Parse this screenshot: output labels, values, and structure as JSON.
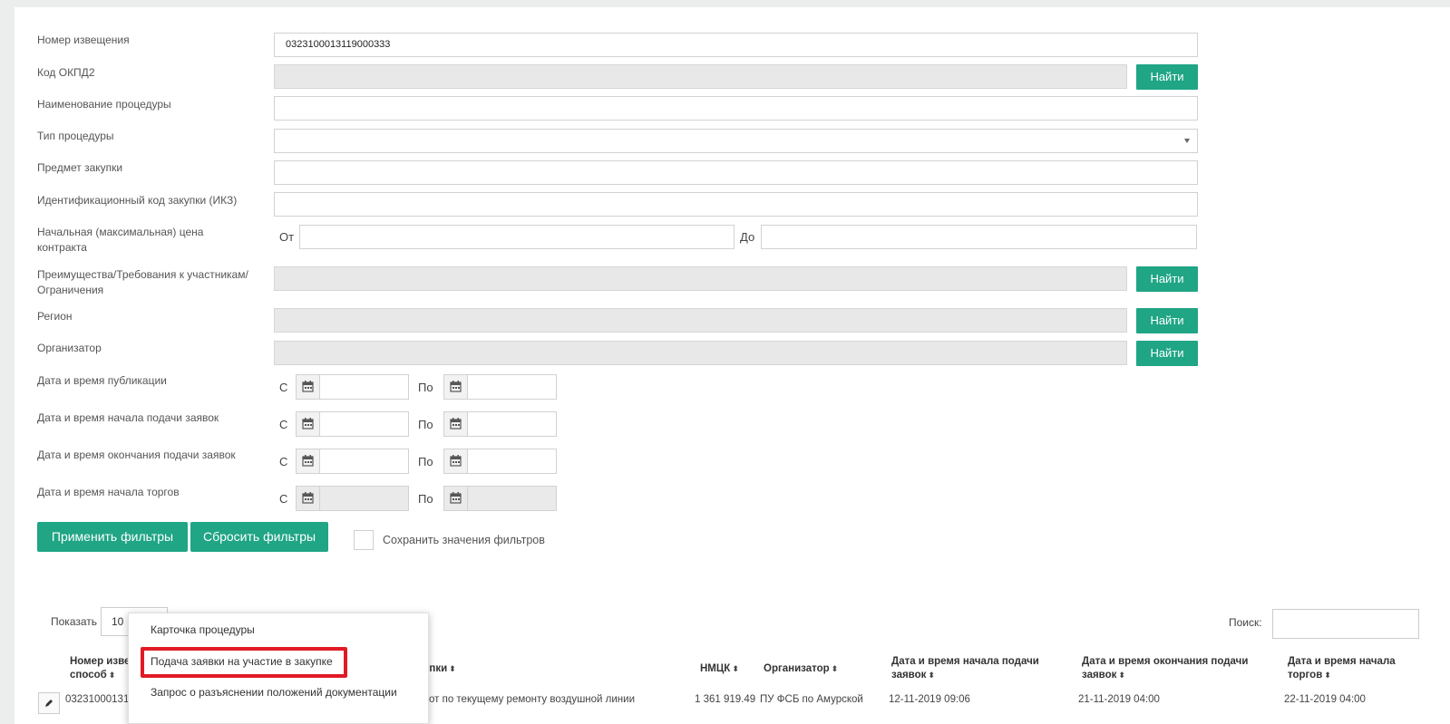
{
  "form": {
    "notice_number": {
      "label": "Номер извещения",
      "value": "0323100013119000333"
    },
    "okpd2": {
      "label": "Код ОКПД2",
      "value": ""
    },
    "procedure_name": {
      "label": "Наименование процедуры",
      "value": ""
    },
    "procedure_type": {
      "label": "Тип процедуры",
      "value": ""
    },
    "purchase_subject": {
      "label": "Предмет закупки",
      "value": ""
    },
    "ikz": {
      "label": "Идентификационный код закупки (ИКЗ)",
      "value": ""
    },
    "price": {
      "label_line1": "Начальная (максимальная) цена",
      "label_line2": "контракта",
      "from_label": "От",
      "to_label": "До",
      "from_value": "",
      "to_value": ""
    },
    "advantages": {
      "label_line1": "Преимущества/Требования к участникам/",
      "label_line2": "Ограничения",
      "value": ""
    },
    "region": {
      "label": "Регион",
      "value": ""
    },
    "organizer": {
      "label": "Организатор",
      "value": ""
    },
    "find_label": "Найти",
    "date_from_label": "С",
    "date_to_label": "По",
    "dates": [
      {
        "label": "Дата и время публикации",
        "from": "",
        "to": ""
      },
      {
        "label": "Дата и время начала подачи заявок",
        "from": "",
        "to": ""
      },
      {
        "label": "Дата и время окончания подачи заявок",
        "from": "",
        "to": ""
      },
      {
        "label": "Дата и время начала торгов",
        "from": "",
        "to": ""
      }
    ],
    "apply_label": "Применить фильтры",
    "reset_label": "Сбросить фильтры",
    "save_label": "Сохранить значения фильтров"
  },
  "table": {
    "show_label": "Показать",
    "page_size": "10",
    "search_label": "Поиск:",
    "search_value": "",
    "columns": {
      "number_line1": "Номер изве",
      "number_line2": "способ",
      "subject": "упки",
      "nmck": "НМЦК",
      "organizer": "Организатор",
      "start_line1": "Дата и время начала подачи",
      "start_line2": "заявок",
      "end_line1": "Дата и время окончания подачи",
      "end_line2": "заявок",
      "trade_line1": "Дата и время начала",
      "trade_line2": "торгов"
    },
    "row": {
      "number": "032310001311",
      "subject": "абот по текущему ремонту воздушной линии",
      "nmck": "1 361 919.49",
      "organizer": "ПУ ФСБ по Амурской",
      "start": "12-11-2019 09:06",
      "end": "21-11-2019 04:00",
      "trade": "22-11-2019 04:00"
    }
  },
  "context_menu": {
    "items": [
      "Карточка процедуры",
      "Подача заявки на участие в закупке",
      "Запрос о разъяснении положений документации"
    ]
  },
  "colors": {
    "accent": "#20a585",
    "highlight": "#e01b24"
  }
}
